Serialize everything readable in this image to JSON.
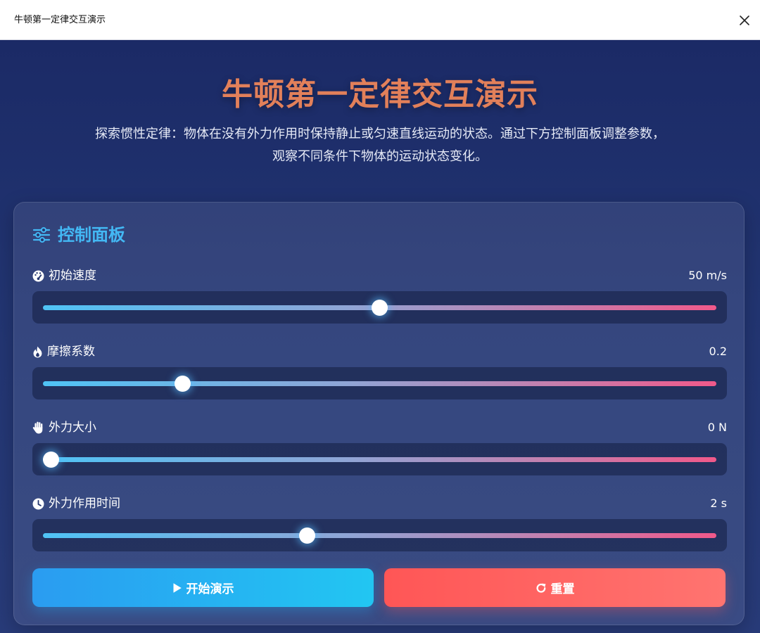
{
  "window": {
    "title": "牛顿第一定律交互演示",
    "close_icon": "close-icon"
  },
  "hero": {
    "title": "牛顿第一定律交互演示",
    "description": "探索惯性定律：物体在没有外力作用时保持静止或匀速直线运动的状态。通过下方控制面板调整参数，观察不同条件下物体的运动状态变化。"
  },
  "panel": {
    "title": "控制面板",
    "icon": "sliders-icon",
    "controls": [
      {
        "label": "初始速度",
        "value_text": "50 m/s",
        "icon": "gauge-icon",
        "fraction": 0.5
      },
      {
        "label": "摩擦系数",
        "value_text": "0.2",
        "icon": "fire-icon",
        "fraction": 0.2
      },
      {
        "label": "外力大小",
        "value_text": "0 N",
        "icon": "hand-icon",
        "fraction": 0.0
      },
      {
        "label": "外力作用时间",
        "value_text": "2 s",
        "icon": "clock-icon",
        "fraction": 0.39
      }
    ]
  },
  "buttons": {
    "start": {
      "label": "开始演示",
      "icon": "play-icon"
    },
    "reset": {
      "label": "重置",
      "icon": "redo-icon"
    }
  },
  "colors": {
    "accent_title": "#e2805a",
    "panel_title": "#43b8f4",
    "start_button": "#22b4f2",
    "reset_button": "#ff5a5a",
    "slider_start": "#4fc3f5",
    "slider_end": "#f0598a"
  }
}
